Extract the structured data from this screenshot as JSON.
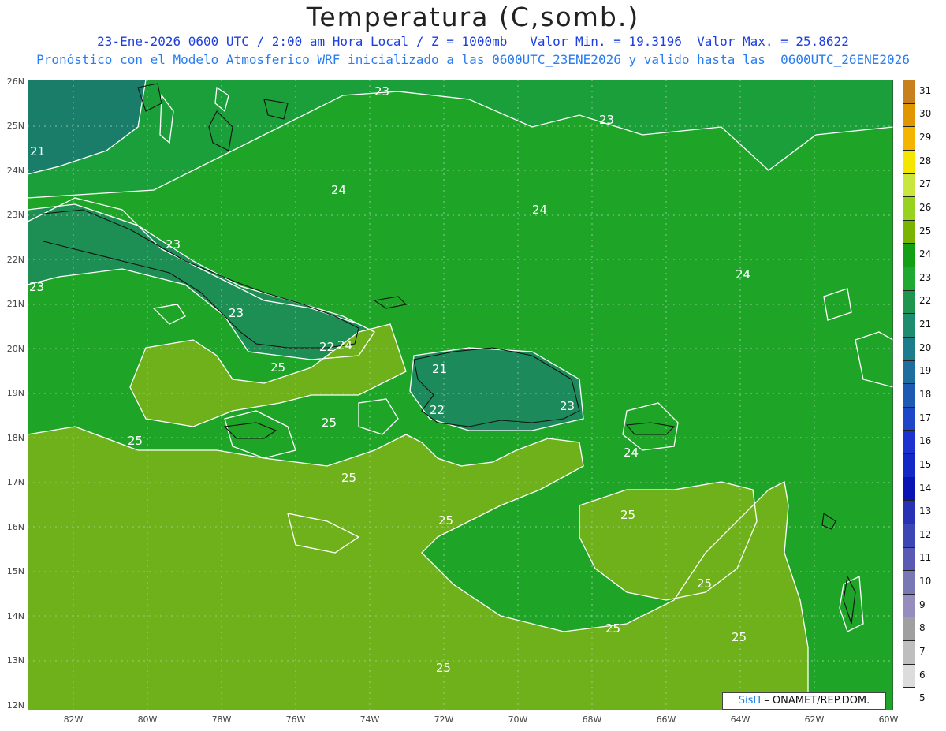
{
  "header": {
    "title": "Temperatura (C,somb.)",
    "line1": "23-Ene-2026 0600 UTC / 2:00 am Hora Local / Z = 1000mb   Valor Min. = 19.3196  Valor Max. = 25.8622",
    "line2": "Pronóstico con el Modelo Atmosferico WRF inicializado a las 0600UTC_23ENE2026 y valido hasta las  0600UTC_26ENE2026"
  },
  "axes": {
    "lat_labels": [
      "26N",
      "25N",
      "24N",
      "23N",
      "22N",
      "21N",
      "20N",
      "19N",
      "18N",
      "17N",
      "16N",
      "15N",
      "14N",
      "13N",
      "12N"
    ],
    "lon_labels": [
      "82W",
      "80W",
      "78W",
      "76W",
      "74W",
      "72W",
      "70W",
      "68W",
      "66W",
      "64W",
      "62W",
      "60W"
    ]
  },
  "contour_labels": [
    "23",
    "23",
    "21",
    "24",
    "24",
    "23",
    "24",
    "23",
    "23",
    "22",
    "24",
    "25",
    "21",
    "22",
    "23",
    "25",
    "25",
    "25",
    "24",
    "25",
    "25",
    "25",
    "25",
    "25",
    "25",
    "25",
    "23"
  ],
  "colorbar": {
    "labels": [
      "31",
      "30",
      "29",
      "28",
      "27",
      "26",
      "25",
      "24",
      "23",
      "22",
      "21",
      "20",
      "19",
      "18",
      "17",
      "16",
      "15",
      "14",
      "13",
      "12",
      "11",
      "10",
      "9",
      "8",
      "7",
      "6",
      "5"
    ],
    "colors": [
      "#c8801e",
      "#e19600",
      "#f5b400",
      "#f5e600",
      "#c8e63c",
      "#96d21e",
      "#78b400",
      "#14a014",
      "#1eaa32",
      "#1e9650",
      "#1e8c6e",
      "#1e7d8c",
      "#1e6ea0",
      "#1e5ab4",
      "#1e46c8",
      "#1e32d2",
      "#1428c8",
      "#0a14b4",
      "#2832b4",
      "#3c46b4",
      "#5a5ab4",
      "#7878b4",
      "#968cbe",
      "#a0a0a0",
      "#bebebe",
      "#dcdcdc",
      "#ffffff"
    ]
  },
  "credit": {
    "brand": "SisΠ",
    "text": "– ONAMET/REP.DOM."
  },
  "colors": {
    "green": "#1ea528",
    "olive": "#6eb11a",
    "teal": "#197d6a"
  }
}
